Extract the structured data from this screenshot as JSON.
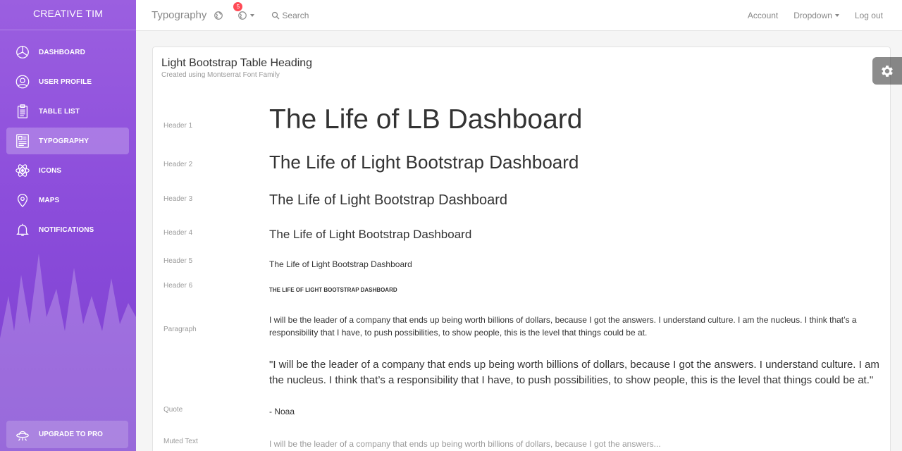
{
  "sidebar": {
    "brand": "CREATIVE TIM",
    "items": [
      {
        "label": "DASHBOARD",
        "icon": "chart-pie-icon"
      },
      {
        "label": "USER PROFILE",
        "icon": "user-circle-icon"
      },
      {
        "label": "TABLE LIST",
        "icon": "clipboard-icon"
      },
      {
        "label": "TYPOGRAPHY",
        "icon": "paper-layout-icon",
        "active": true
      },
      {
        "label": "ICONS",
        "icon": "atom-icon"
      },
      {
        "label": "MAPS",
        "icon": "map-pin-icon"
      },
      {
        "label": "NOTIFICATIONS",
        "icon": "bell-icon"
      }
    ],
    "upgrade_label": "UPGRADE TO PRO"
  },
  "topbar": {
    "title": "Typography",
    "notification_count": "5",
    "search_label": "Search",
    "links": [
      "Account",
      "Dropdown",
      "Log out"
    ]
  },
  "card": {
    "title": "Light Bootstrap Table Heading",
    "subtitle": "Created using Montserrat Font Family",
    "rows": {
      "h1": {
        "label": "Header 1",
        "text": "The Life of LB Dashboard"
      },
      "h2": {
        "label": "Header 2",
        "text": "The Life of Light Bootstrap Dashboard"
      },
      "h3": {
        "label": "Header 3",
        "text": "The Life of Light Bootstrap Dashboard"
      },
      "h4": {
        "label": "Header 4",
        "text": "The Life of Light Bootstrap Dashboard"
      },
      "h5": {
        "label": "Header 5",
        "text": "The Life of Light Bootstrap Dashboard"
      },
      "h6": {
        "label": "Header 6",
        "text": "THE LIFE OF LIGHT BOOTSTRAP DASHBOARD"
      },
      "paragraph": {
        "label": "Paragraph",
        "text": "I will be the leader of a company that ends up being worth billions of dollars, because I got the answers. I understand culture. I am the nucleus. I think that’s a responsibility that I have, to push possibilities, to show people, this is the level that things could be at."
      },
      "quote": {
        "label": "Quote",
        "text": "\"I will be the leader of a company that ends up being worth billions of dollars, because I got the answers. I understand culture. I am the nucleus. I think that’s a responsibility that I have, to push possibilities, to show people, this is the level that things could be at.\"",
        "author": "- Noaa"
      },
      "muted": {
        "label": "Muted Text",
        "text": "I will be the leader of a company that ends up being worth billions of dollars, because I got the answers..."
      }
    }
  },
  "colors": {
    "sidebar_top": "#9b5fe0",
    "sidebar_bottom": "#7b3fd0",
    "badge": "#ff4a55",
    "muted": "#9a9a9a"
  }
}
